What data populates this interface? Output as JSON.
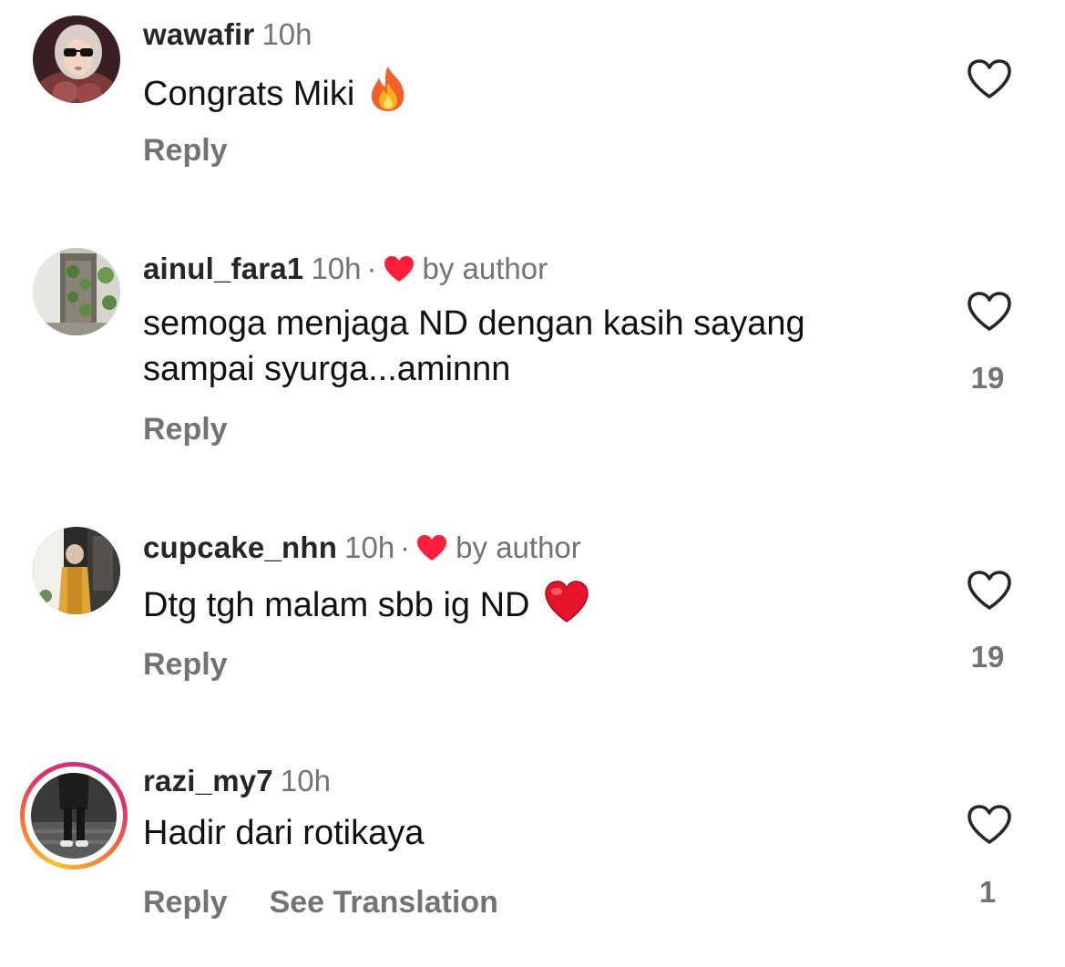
{
  "comments": [
    {
      "username": "wawafir",
      "time": "10h",
      "by_author": false,
      "text": "Congrats Miki",
      "emoji": "fire-emoji",
      "reply_label": "Reply",
      "likes": null
    },
    {
      "username": "ainul_fara1",
      "time": "10h",
      "separator": "·",
      "by_author": true,
      "by_author_label": "by author",
      "text_line1": "semoga menjaga ND dengan kasih sayang",
      "text_line2": "sampai syurga...aminnn",
      "reply_label": "Reply",
      "likes": "19"
    },
    {
      "username": "cupcake_nhn",
      "time": "10h",
      "separator": "·",
      "by_author": true,
      "by_author_label": "by author",
      "text": "Dtg tgh malam sbb ig ND",
      "emoji": "red-heart-emoji",
      "reply_label": "Reply",
      "likes": "19"
    },
    {
      "username": "razi_my7",
      "time": "10h",
      "by_author": false,
      "has_story": true,
      "text": "Hadir dari rotikaya",
      "reply_label": "Reply",
      "see_translation_label": "See Translation",
      "likes": "1"
    }
  ],
  "colors": {
    "username": "#262626",
    "secondary": "#737373",
    "author_heart": "#ff1f3d",
    "like_outline": "#262626"
  },
  "icons": {
    "like": "heart-outline-icon",
    "author_like": "heart-filled-icon"
  }
}
